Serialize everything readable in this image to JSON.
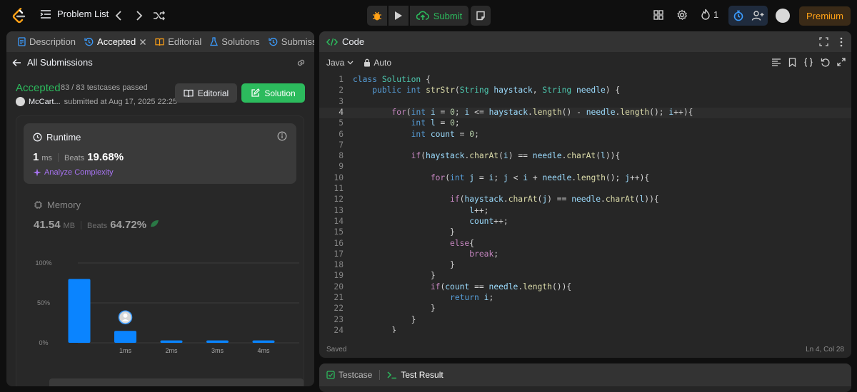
{
  "nav": {
    "problem_list": "Problem List",
    "submit": "Submit",
    "streak": "1",
    "premium": "Premium"
  },
  "tabs": [
    {
      "label": "Description"
    },
    {
      "label": "Accepted"
    },
    {
      "label": "Editorial"
    },
    {
      "label": "Solutions"
    },
    {
      "label": "Submissio"
    }
  ],
  "submission": {
    "back_label": "All Submissions",
    "status": "Accepted",
    "testcases": "83 / 83 testcases passed",
    "user": "McCart...",
    "submitted_at": "submitted at Aug 17, 2025 22:25",
    "editorial_btn": "Editorial",
    "solution_btn": "Solution"
  },
  "runtime": {
    "title": "Runtime",
    "value": "1",
    "unit": "ms",
    "beats_label": "Beats",
    "beats": "19.68%",
    "analyze": "Analyze Complexity"
  },
  "memory": {
    "title": "Memory",
    "value": "41.54",
    "unit": "MB",
    "beats_label": "Beats",
    "beats": "64.72%"
  },
  "chart_data": {
    "type": "bar",
    "categories": [
      "",
      "1ms",
      "2ms",
      "3ms",
      "4ms"
    ],
    "values": [
      80,
      15,
      3,
      3,
      3
    ],
    "y_ticks": [
      "100%",
      "50%",
      "0%"
    ],
    "ylim": [
      0,
      100
    ],
    "highlight_index": 1,
    "bar_color": "#0a84ff"
  },
  "code": {
    "title": "Code",
    "language": "Java",
    "mode": "Auto",
    "status_left": "Saved",
    "status_right": "Ln 4, Col 28",
    "current_line": 4,
    "lines": [
      "class Solution {",
      "    public int strStr(String haystack, String needle) {",
      "",
      "        for(int i = 0; i <= haystack.length() - needle.length(); i++){",
      "            int l = 0;",
      "            int count = 0;",
      "",
      "            if(haystack.charAt(i) == needle.charAt(l)){",
      "",
      "                for(int j = i; j < i + needle.length(); j++){",
      "",
      "                    if(haystack.charAt(j) == needle.charAt(l)){",
      "                        l++;",
      "                        count++;",
      "                    }",
      "                    else{",
      "                        break;",
      "                    }",
      "                }",
      "                if(count == needle.length()){",
      "                    return i;",
      "                }",
      "            }",
      "        }"
    ]
  },
  "bottom": {
    "testcase": "Testcase",
    "test_result": "Test Result"
  },
  "colors": {
    "accent_green": "#2cbb5d",
    "premium": "#ffa116",
    "bar_blue": "#0a84ff"
  }
}
